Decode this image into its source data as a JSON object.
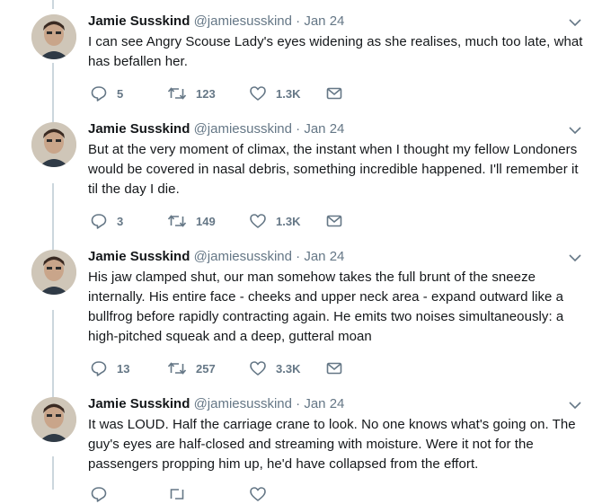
{
  "tweets": [
    {
      "name": "Jamie Susskind",
      "handle": "@jamiesusskind",
      "separator": "·",
      "date": "Jan 24",
      "text": "I can see Angry Scouse Lady's eyes widening as she realises, much too late, what has befallen her.",
      "replies": "5",
      "retweets": "123",
      "likes": "1.3K"
    },
    {
      "name": "Jamie Susskind",
      "handle": "@jamiesusskind",
      "separator": "·",
      "date": "Jan 24",
      "text": "But at the very moment of climax, the instant when I thought my fellow Londoners would be covered in nasal debris, something incredible happened. I'll remember it til the day I die.",
      "replies": "3",
      "retweets": "149",
      "likes": "1.3K"
    },
    {
      "name": "Jamie Susskind",
      "handle": "@jamiesusskind",
      "separator": "·",
      "date": "Jan 24",
      "text": "His jaw clamped shut, our man somehow takes the full brunt of the sneeze internally. His entire face - cheeks and upper neck area - expand outward like a bullfrog before rapidly contracting again. He emits two noises simultaneously: a high-pitched squeak and a deep, gutteral moan",
      "replies": "13",
      "retweets": "257",
      "likes": "3.3K"
    },
    {
      "name": "Jamie Susskind",
      "handle": "@jamiesusskind",
      "separator": "·",
      "date": "Jan 24",
      "text": "It was LOUD. Half the carriage crane to look. No one knows what's going on. The guy's eyes are half-closed and streaming with moisture. Were it not for the passengers propping him up, he'd have collapsed from the effort.",
      "replies": "",
      "retweets": "",
      "likes": ""
    }
  ],
  "icons": {
    "reply": "reply-icon",
    "retweet": "retweet-icon",
    "like": "heart-icon",
    "dm": "envelope-icon",
    "caret": "chevron-down-icon"
  },
  "colors": {
    "text": "#14171a",
    "secondary": "#657786",
    "thread_line": "#ccd6dd"
  }
}
